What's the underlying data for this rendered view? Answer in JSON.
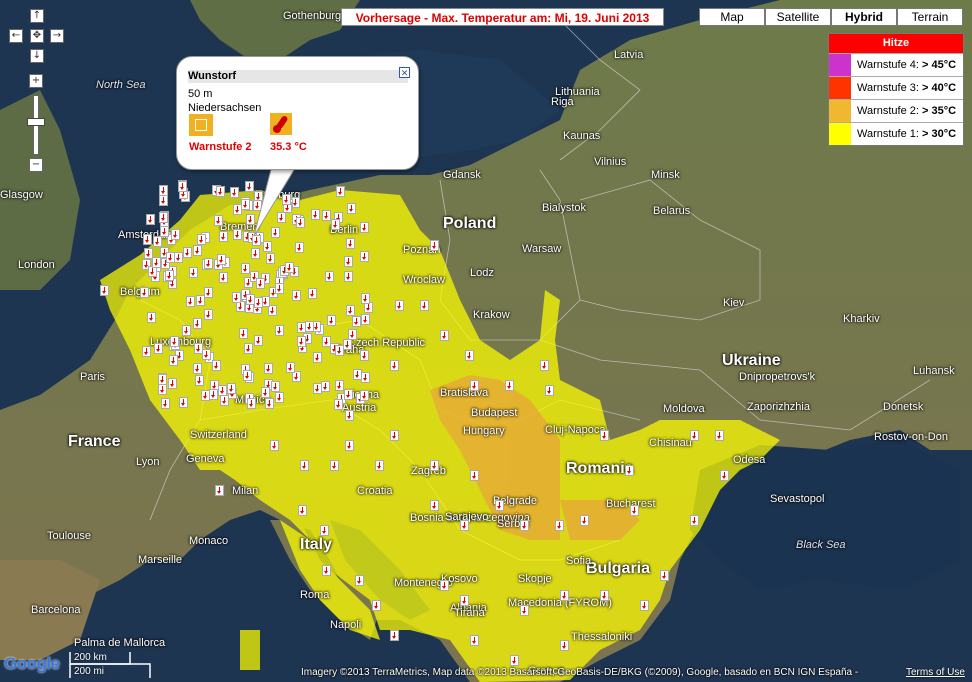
{
  "forecast_title": "Vorhersage - Max. Temperatur am: Mi, 19. Juni 2013",
  "map_types": [
    "Map",
    "Satellite",
    "Hybrid",
    "Terrain"
  ],
  "active_map_type": "Hybrid",
  "legend": {
    "header": "Hitze",
    "header_color": "#ff0000",
    "rows": [
      {
        "prefix": "Warnstufe 4: ",
        "value": "> 45°C",
        "color": "#cc33cc"
      },
      {
        "prefix": "Warnstufe 3: ",
        "value": "> 40°C",
        "color": "#ff3300"
      },
      {
        "prefix": "Warnstufe 2: ",
        "value": "> 35°C",
        "color": "#f0b830"
      },
      {
        "prefix": "Warnstufe 1: ",
        "value": "> 30°C",
        "color": "#ffff00"
      }
    ]
  },
  "popup": {
    "name": "Wunstorf",
    "elevation": "50 m",
    "region": "Niedersachsen",
    "warn_label": "Warnstufe 2",
    "temperature": "35.3  °C"
  },
  "navigation": {
    "up": "↑",
    "down": "↓",
    "left": "←",
    "right": "→",
    "center": "✥",
    "zoom_in": "+",
    "zoom_out": "−"
  },
  "countries": [
    {
      "name": "Latvia",
      "big": false
    },
    {
      "name": "Lithuania",
      "big": false
    },
    {
      "name": "Belarus",
      "big": false
    },
    {
      "name": "Poland",
      "big": true
    },
    {
      "name": "Ukraine",
      "big": true
    },
    {
      "name": "France",
      "big": true
    },
    {
      "name": "Switzerland",
      "big": false
    },
    {
      "name": "Czech Republic",
      "big": false
    },
    {
      "name": "Austria",
      "big": false
    },
    {
      "name": "Hungary",
      "big": false
    },
    {
      "name": "Romania",
      "big": true
    },
    {
      "name": "Moldova",
      "big": false
    },
    {
      "name": "Croatia",
      "big": false
    },
    {
      "name": "Bosnia and Herzegovina",
      "big": false
    },
    {
      "name": "Serbia",
      "big": false
    },
    {
      "name": "Bulgaria",
      "big": true
    },
    {
      "name": "Italy",
      "big": true
    },
    {
      "name": "Montenegro",
      "big": false
    },
    {
      "name": "Albania",
      "big": false
    },
    {
      "name": "Macedonia (FYROM)",
      "big": false
    },
    {
      "name": "Kosovo",
      "big": false
    },
    {
      "name": "Greece",
      "big": false
    }
  ],
  "cities": [
    "Gothenburg",
    "Riga",
    "Kaunas",
    "Vilnius",
    "Minsk",
    "Gdansk",
    "Bialystok",
    "Warsaw",
    "Lodz",
    "Poznan",
    "Wroclaw",
    "Krakow",
    "Kiev",
    "Kharkiv",
    "Amsterdam",
    "London",
    "Belgium",
    "Luxembourg",
    "Paris",
    "Lyon",
    "Geneva",
    "Milan",
    "Monaco",
    "Marseille",
    "Toulouse",
    "Barcelona",
    "Palma de Mallorca",
    "Bratislava",
    "Budapest",
    "Cluj-Napoca",
    "Zagreb",
    "Sarajevo",
    "Belgrade",
    "Bucharest",
    "Sofia",
    "Skopje",
    "Tirana",
    "Thessaloniki",
    "Chisinau",
    "Odesa",
    "Sevastopol",
    "Dnipropetrovs'k",
    "Zaporizhzhia",
    "Donetsk",
    "Luhansk",
    "Rostov-on-Don",
    "Vienna",
    "Munich",
    "Praha",
    "Berlin",
    "Hamburg",
    "Bremen",
    "Glasgow",
    "Roma",
    "Napoli"
  ],
  "seas": [
    "North Sea",
    "Black Sea"
  ],
  "google_logo": "Google",
  "scale": {
    "km": "200 km",
    "mi": "200 mi"
  },
  "attribution": "Imagery ©2013 TerraMetrics, Map data ©2013 Basarsoft, GeoBasis-DE/BKG (©2009), Google, basado en BCN IGN España -",
  "terms": "Terms of Use"
}
